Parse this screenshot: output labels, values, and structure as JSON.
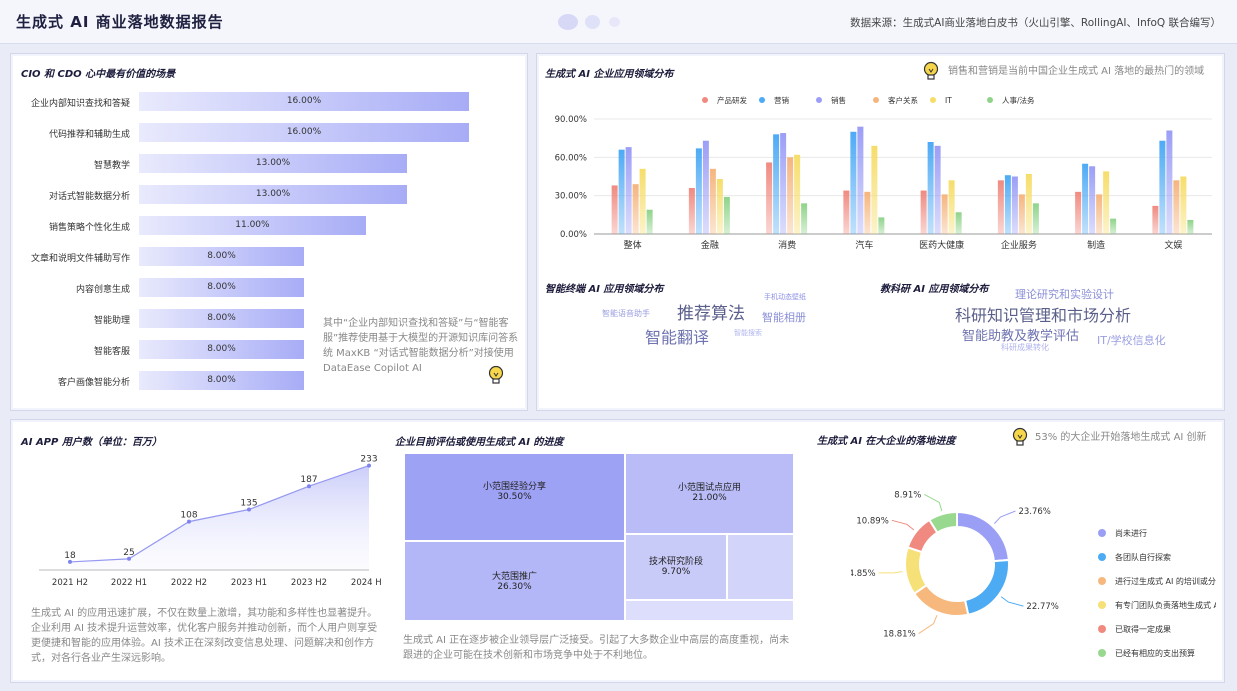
{
  "header": {
    "title": "生成式 AI 商业落地数据报告",
    "source": "数据来源：生成式AI商业落地白皮书（火山引擎、RollingAI、InfoQ 联合编写）"
  },
  "cio": {
    "title": "CIO 和 CDO 心中最有价值的场景",
    "note": "其中“企业内部知识查找和答疑”与“智能客服”推荐使用基于大模型的开源知识库问答系统 MaxKB “对话式智能数据分析”对接使用 DataEase Copilot AI"
  },
  "domain": {
    "title": "生成式 AI 企业应用领域分布",
    "note": "销售和营销是当前中国企业生成式 AI 落地的最热门的领域"
  },
  "terminal": {
    "title": "智能终端 AI 应用领域分布"
  },
  "edu": {
    "title": "教科研 AI 应用领域分布"
  },
  "app": {
    "title": "AI APP 用户数（单位：百万）",
    "note": "生成式 AI 的应用迅速扩展，不仅在数量上激增，其功能和多样性也显著提升。企业利用 AI 技术提升运营效率，优化客户服务并推动创新，而个人用户则享受更便捷和智能的应用体验。AI 技术正在深刻改变信息处理、问题解决和创作方式，对各行各业产生深远影响。"
  },
  "progress": {
    "title": "企业目前评估或使用生成式 AI 的进度",
    "note": "生成式 AI 正在逐步被企业领导层广泛接受。引起了大多数企业中高层的高度重视，尚未跟进的企业可能在技术创新和市场竞争中处于不利地位。"
  },
  "landing": {
    "title": "生成式 AI 在大企业的落地进度",
    "note": "53% 的大企业开始落地生成式 AI 创新"
  },
  "chart_data": [
    {
      "type": "bar",
      "orientation": "horizontal",
      "title": "CIO 和 CDO 心中最有价值的场景",
      "categories": [
        "企业内部知识查找和答疑",
        "代码推荐和辅助生成",
        "智慧教学",
        "对话式智能数据分析",
        "销售策略个性化生成",
        "文章和说明文件辅助写作",
        "内容创意生成",
        "智能助理",
        "智能客服",
        "客户画像智能分析"
      ],
      "values": [
        16,
        16,
        13,
        13,
        11,
        8,
        8,
        8,
        8,
        8
      ],
      "value_labels": [
        "16.00%",
        "16.00%",
        "13.00%",
        "13.00%",
        "11.00%",
        "8.00%",
        "8.00%",
        "8.00%",
        "8.00%",
        "8.00%"
      ]
    },
    {
      "type": "bar",
      "title": "生成式 AI 企业应用领域分布",
      "categories": [
        "整体",
        "金融",
        "消费",
        "汽车",
        "医药大健康",
        "企业服务",
        "制造",
        "文娱"
      ],
      "ylim": [
        0,
        90
      ],
      "yticks": [
        "0.00%",
        "30.00%",
        "60.00%",
        "90.00%"
      ],
      "legend_position": "top",
      "series": [
        {
          "name": "产品研发",
          "color": "#f08a80",
          "values": [
            38,
            36,
            56,
            34,
            34,
            42,
            33,
            22
          ]
        },
        {
          "name": "营销",
          "color": "#4daaf5",
          "values": [
            66,
            67,
            78,
            80,
            72,
            46,
            55,
            73
          ]
        },
        {
          "name": "销售",
          "color": "#9b9ef6",
          "values": [
            68,
            73,
            79,
            84,
            69,
            45,
            53,
            81
          ]
        },
        {
          "name": "客户关系",
          "color": "#f5b57e",
          "values": [
            39,
            51,
            60,
            33,
            31,
            31,
            31,
            42
          ]
        },
        {
          "name": "IT",
          "color": "#f6dd6a",
          "values": [
            51,
            43,
            62,
            69,
            42,
            47,
            49,
            45
          ]
        },
        {
          "name": "人事/法务",
          "color": "#8fd38a",
          "values": [
            19,
            29,
            24,
            13,
            17,
            24,
            12,
            11
          ]
        }
      ]
    },
    {
      "type": "wordcloud",
      "title": "智能终端 AI 应用领域分布",
      "words": [
        {
          "text": "推荐算法",
          "size": 17,
          "color": "#5a5f8a"
        },
        {
          "text": "智能翻译",
          "size": 16,
          "color": "#6f73b0"
        },
        {
          "text": "智能相册",
          "size": 11,
          "color": "#8a8fd8"
        },
        {
          "text": "智能语音助手",
          "size": 8,
          "color": "#9a9fe0"
        },
        {
          "text": "手机动态壁纸",
          "size": 7,
          "color": "#8c90e8"
        },
        {
          "text": "智能搜索",
          "size": 7,
          "color": "#b0b4ee"
        }
      ]
    },
    {
      "type": "wordcloud",
      "title": "教科研 AI 应用领域分布",
      "words": [
        {
          "text": "科研知识管理和市场分析",
          "size": 16,
          "color": "#5a5f8a"
        },
        {
          "text": "智能助教及教学评估",
          "size": 13,
          "color": "#6f73b0"
        },
        {
          "text": "理论研究和实验设计",
          "size": 11,
          "color": "#8a8fd8"
        },
        {
          "text": "IT/学校信息化",
          "size": 11,
          "color": "#9a9fe0"
        },
        {
          "text": "科研成果转化",
          "size": 8,
          "color": "#b0b4ee"
        }
      ]
    },
    {
      "type": "area",
      "title": "AI APP 用户数（单位：百万）",
      "categories": [
        "2021 H2",
        "2022 H1",
        "2022 H2",
        "2023 H1",
        "2023 H2",
        "2024 H1"
      ],
      "values": [
        18,
        25,
        108,
        135,
        187,
        233
      ],
      "ylim": [
        0,
        250
      ]
    },
    {
      "type": "treemap",
      "title": "企业目前评估或使用生成式 AI 的进度",
      "items": [
        {
          "name": "小范围经验分享",
          "value": 30.5,
          "label": "30.50%",
          "color": "#9ea2f5"
        },
        {
          "name": "大范围推广",
          "value": 26.3,
          "label": "26.30%",
          "color": "#b4b7f7"
        },
        {
          "name": "小范围试点应用",
          "value": 21.0,
          "label": "21.00%",
          "color": "#b9bcf7"
        },
        {
          "name": "技术研究阶段",
          "value": 9.7,
          "label": "9.70%",
          "color": "#c8caf8"
        }
      ]
    },
    {
      "type": "pie",
      "donut": true,
      "title": "生成式 AI 在大企业的落地进度",
      "items": [
        {
          "name": "尚未进行",
          "value": 23.76,
          "label": "23.76%",
          "color": "#9a9ef5"
        },
        {
          "name": "各团队自行探索",
          "value": 22.77,
          "label": "22.77%",
          "color": "#4dabf4"
        },
        {
          "name": "进行过生成式 AI 的培训或分享",
          "value": 18.81,
          "label": "18.81%",
          "color": "#f7b87e"
        },
        {
          "name": "有专门团队负责落地生成式 AI",
          "value": 14.85,
          "label": "14.85%",
          "color": "#f6e078"
        },
        {
          "name": "已取得一定成果",
          "value": 10.89,
          "label": "10.89%",
          "color": "#f08a80"
        },
        {
          "name": "已经有相应的支出预算",
          "value": 8.91,
          "label": "8.91%",
          "color": "#98d98f"
        }
      ]
    }
  ]
}
